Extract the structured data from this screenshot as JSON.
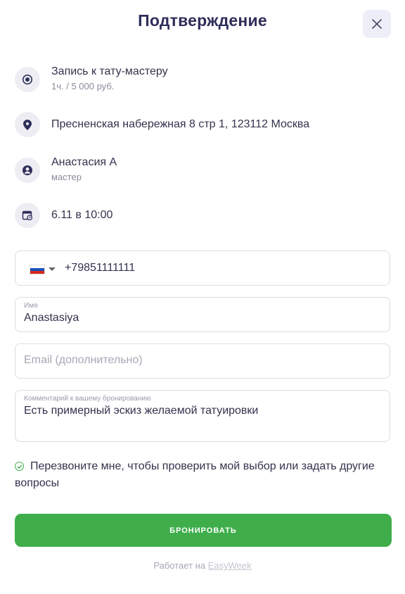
{
  "header": {
    "title": "Подтверждение",
    "close_icon": "close-icon"
  },
  "booking": {
    "service": {
      "icon": "radio-target-icon",
      "title": "Запись к тату-мастеру",
      "details": "1ч. / 5 000 руб."
    },
    "location": {
      "icon": "map-pin-icon",
      "address": "Пресненская набережная 8 стр 1, 123112 Москва"
    },
    "master": {
      "icon": "user-icon",
      "name": "Анастасия А",
      "role": "мастер"
    },
    "datetime": {
      "icon": "calendar-clock-icon",
      "value": "6.11 в 10:00"
    }
  },
  "form": {
    "phone": {
      "country_flag": "russia-flag-icon",
      "value": "+79851111111"
    },
    "name": {
      "label": "Имя",
      "value": "Anastasiya"
    },
    "email": {
      "placeholder": "Email (дополнительно)"
    },
    "comment": {
      "label": "Комментарий к вашему бронированию",
      "value": "Есть примерный эскиз желаемой татуировки"
    },
    "callback": {
      "checked": true,
      "label": "Перезвоните мне, чтобы проверить мой выбор или задать другие вопросы"
    }
  },
  "actions": {
    "book_label": "БРОНИРОВАТЬ"
  },
  "footer": {
    "powered_by": "Работает на",
    "brand": "EasyWeek"
  },
  "colors": {
    "accent_green": "#3fae4a",
    "title_navy": "#2e2e5a",
    "icon_bg": "#ededf3"
  }
}
